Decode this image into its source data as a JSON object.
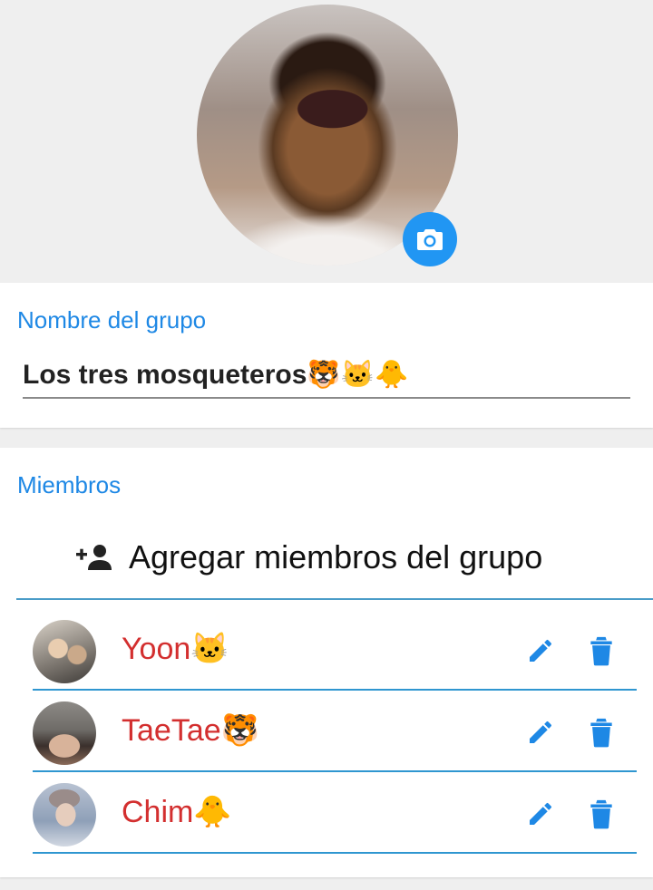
{
  "colors": {
    "accent": "#2196f3",
    "label_blue": "#1e88e5",
    "member_name_red": "#d32f2f"
  },
  "group_photo": {
    "icon": "camera-icon"
  },
  "name_section": {
    "label": "Nombre del grupo",
    "value": "Los tres mosqueteros🐯🐱🐥"
  },
  "members_section": {
    "label": "Miembros",
    "add_label": "Agregar miembros del grupo",
    "add_icon": "person-add-icon",
    "members": [
      {
        "name": "Yoon🐱",
        "edit_icon": "pencil-icon",
        "delete_icon": "trash-icon"
      },
      {
        "name": "TaeTae🐯",
        "edit_icon": "pencil-icon",
        "delete_icon": "trash-icon"
      },
      {
        "name": "Chim🐥",
        "edit_icon": "pencil-icon",
        "delete_icon": "trash-icon"
      }
    ]
  }
}
